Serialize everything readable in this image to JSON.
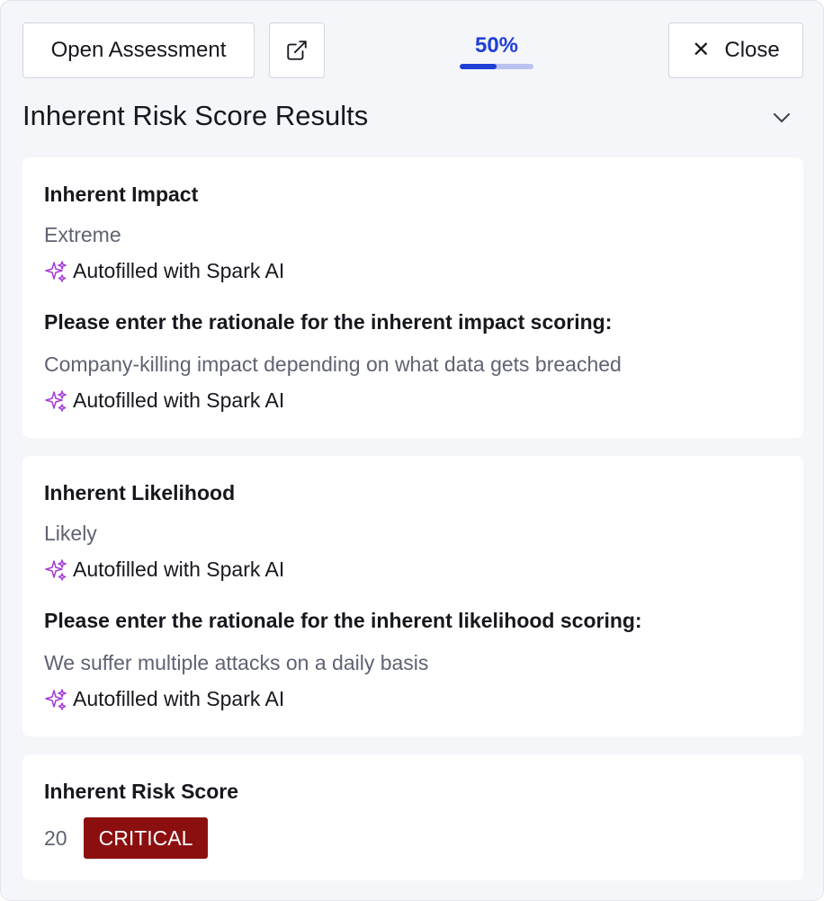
{
  "toolbar": {
    "open_label": "Open Assessment",
    "external_icon": "external-link-icon",
    "close_label": "Close",
    "close_icon": "close-icon"
  },
  "progress": {
    "label": "50%",
    "value": 0.5
  },
  "section": {
    "title": "Inherent Risk Score Results",
    "toggle_icon": "chevron-down-icon"
  },
  "impact": {
    "label": "Inherent Impact",
    "value": "Extreme",
    "value_ai": "Autofilled with Spark AI",
    "rationale_label": "Please enter the rationale for the inherent impact scoring:",
    "rationale_value": "Company-killing impact depending on what data gets breached",
    "rationale_ai": "Autofilled with Spark AI"
  },
  "likelihood": {
    "label": "Inherent Likelihood",
    "value": "Likely",
    "value_ai": "Autofilled with Spark AI",
    "rationale_label": "Please enter the rationale for the inherent likelihood scoring:",
    "rationale_value": "We suffer multiple attacks on a daily basis",
    "rationale_ai": "Autofilled with Spark AI"
  },
  "score": {
    "label": "Inherent Risk Score",
    "value": "20",
    "badge": "CRITICAL"
  },
  "colors": {
    "accent": "#1f3fd6",
    "critical": "#8c0f0f",
    "sparkle": "#a33bd9"
  }
}
